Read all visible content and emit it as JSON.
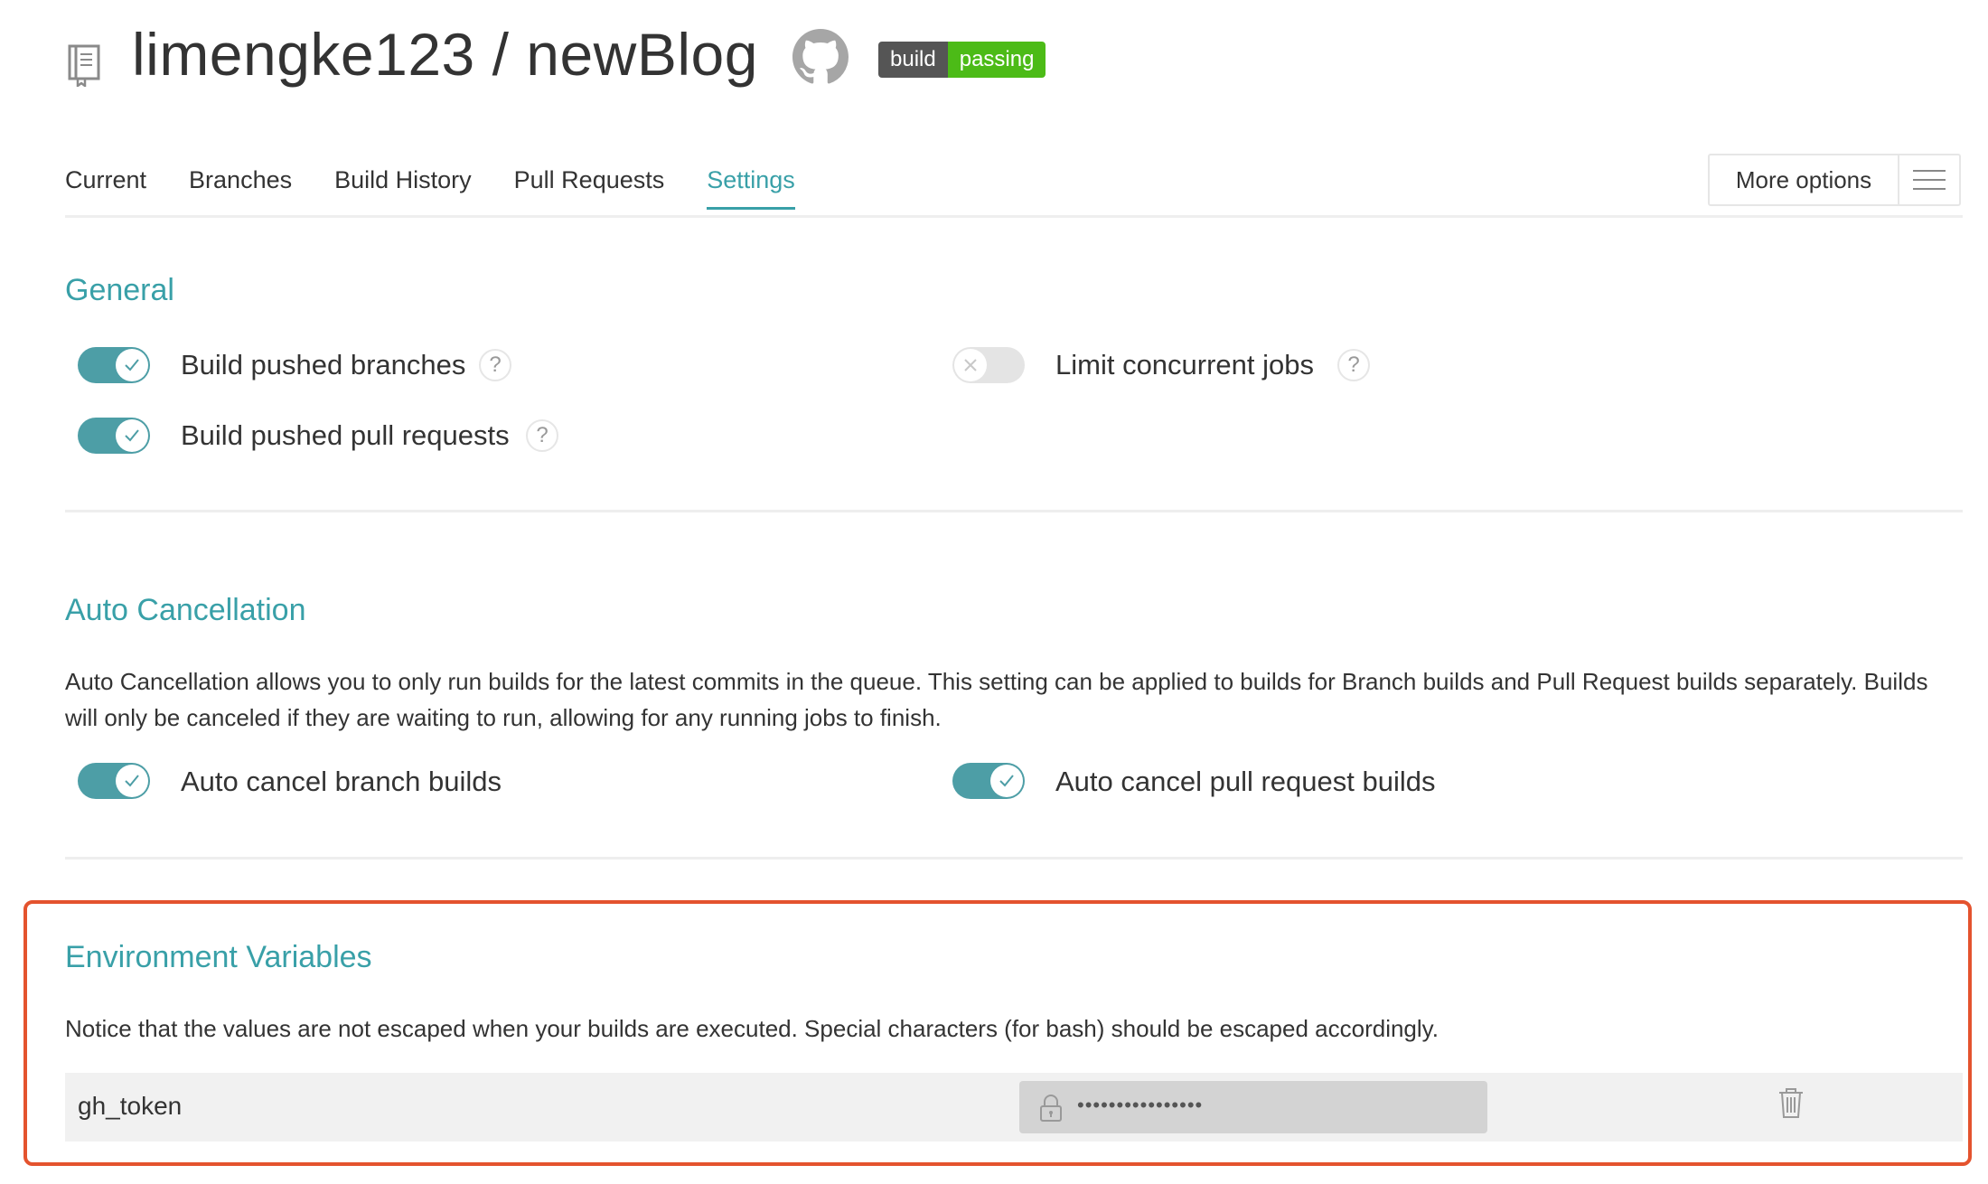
{
  "header": {
    "repo_title": "limengke123 / newBlog",
    "badge": {
      "left": "build",
      "right": "passing"
    }
  },
  "tabs": [
    {
      "label": "Current"
    },
    {
      "label": "Branches"
    },
    {
      "label": "Build History"
    },
    {
      "label": "Pull Requests"
    },
    {
      "label": "Settings",
      "active": true
    }
  ],
  "more_options": {
    "label": "More options"
  },
  "general": {
    "title": "General",
    "settings": [
      {
        "label": "Build pushed branches",
        "enabled": true
      },
      {
        "label": "Build pushed pull requests",
        "enabled": true
      },
      {
        "label": "Limit concurrent jobs",
        "enabled": false
      }
    ],
    "help_glyph": "?"
  },
  "auto_cancellation": {
    "title": "Auto Cancellation",
    "description": "Auto Cancellation allows you to only run builds for the latest commits in the queue. This setting can be applied to builds for Branch builds and Pull Request builds separately. Builds will only be canceled if they are waiting to run, allowing for any running jobs to finish.",
    "settings": [
      {
        "label": "Auto cancel branch builds",
        "enabled": true
      },
      {
        "label": "Auto cancel pull request builds",
        "enabled": true
      }
    ]
  },
  "env_vars": {
    "title": "Environment Variables",
    "notice": "Notice that the values are not escaped when your builds are executed. Special characters (for bash) should be escaped accordingly.",
    "rows": [
      {
        "name": "gh_token",
        "value_masked": "••••••••••••••••"
      }
    ]
  },
  "colors": {
    "accent": "#39a0a8",
    "toggle_on": "#4d9ea6",
    "badge_passing": "#4cbb17",
    "highlight_border": "#e4532e"
  },
  "icons": [
    "repo-icon",
    "github-icon",
    "hamburger-icon",
    "check-icon",
    "x-icon",
    "help-icon",
    "lock-icon",
    "trash-icon"
  ]
}
